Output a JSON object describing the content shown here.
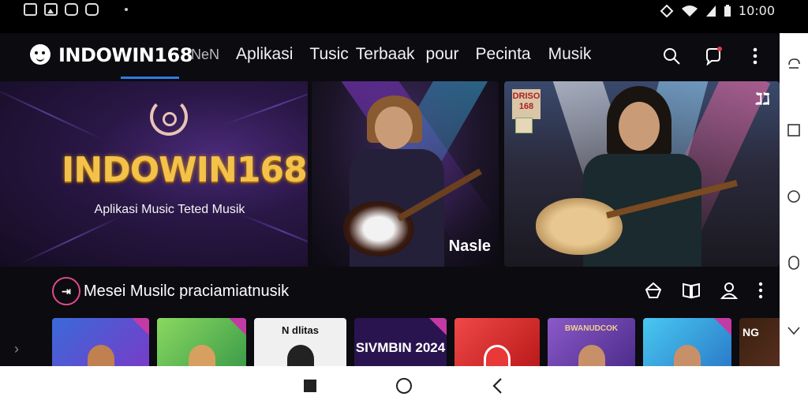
{
  "status_bar": {
    "time": "10:00",
    "icons_left": [
      "image-icon",
      "gallery-icon",
      "shield-icon",
      "message-icon",
      "dot-icon"
    ],
    "icons_right": [
      "vibrate-icon",
      "wifi-icon",
      "sim-icon",
      "battery-icon"
    ]
  },
  "header": {
    "logo_text": "INDOWIN168",
    "tabs": [
      {
        "label": "NeN",
        "active": true
      },
      {
        "label": "Aplikasi",
        "active": false
      },
      {
        "label": "Tusic",
        "active": false
      },
      {
        "label": "Terbaak",
        "active": false
      },
      {
        "label": "pour",
        "active": false
      },
      {
        "label": "Pecinta",
        "active": false
      },
      {
        "label": "Musik",
        "active": false
      }
    ],
    "actions": [
      "search-icon",
      "notification-icon",
      "more-vert-icon"
    ]
  },
  "hero": {
    "title": "INDOWIN168",
    "subtitle": "Aplikasi Music Teted Musik",
    "card1_label": "Nasle",
    "card2_badge": "DRISO 168",
    "card2_corner": "ℷℷ"
  },
  "section": {
    "icon_text": "⇥",
    "title": "Mesei Musilc  praciamiatnusik",
    "actions": [
      "bookmark-share-icon",
      "book-icon",
      "user-icon",
      "more-vert-icon"
    ]
  },
  "thumbnails": [
    {
      "text": "",
      "bg": "#5a3ad0"
    },
    {
      "text": "",
      "bg": "#5ab85a"
    },
    {
      "text": "N dlitas",
      "bg": "#f0f0f0"
    },
    {
      "text": "SIVMBIN 2024",
      "bg": "#3a1a6a"
    },
    {
      "text": "",
      "bg": "#e83838"
    },
    {
      "text": "BWANUDCOK",
      "bg": "#7a4ab8"
    },
    {
      "text": "",
      "bg": "#3aa8e8"
    },
    {
      "text": "NG",
      "bg": "#2a1a10"
    }
  ],
  "colors": {
    "accent": "#2f7de0",
    "hero_gold": "#f3c24a",
    "section_ring": "#e04a8e"
  }
}
